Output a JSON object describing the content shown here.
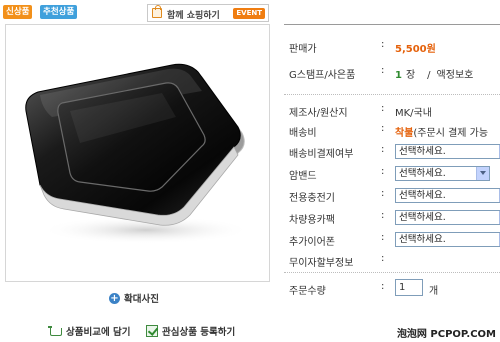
{
  "badges": {
    "left": "신상품",
    "right": "추천상품"
  },
  "event": {
    "label": "함께 쇼핑하기",
    "tag": "EVENT"
  },
  "zoom_label": "확대사진",
  "actions": {
    "compare": "상품비교에 담기",
    "favorite": "관심상품 등록하기"
  },
  "info": {
    "price_label": "판매가",
    "price_value": "5,500원",
    "stamp_label": "G스탬프/사은품",
    "stamp_count": "1",
    "stamp_unit": "장",
    "stamp_gift": "액정보호",
    "maker_label": "제조사/원산지",
    "maker_value": "MK/국내",
    "shipping_label": "배송비",
    "shipping_value": "착불",
    "shipping_note": "(주문시 결제 가능",
    "ship_pay_label": "배송비결제여부",
    "armband_label": "암밴드",
    "charger_label": "전용충전기",
    "car_label": "차량용카팩",
    "earphone_label": "추가이어폰",
    "interest_label": "무이자할부정보",
    "qty_label": "주문수량",
    "qty_value": "1",
    "qty_unit": "개",
    "select_placeholder": "선택하세요."
  },
  "watermark": "泡泡网 PCPOP.COM"
}
